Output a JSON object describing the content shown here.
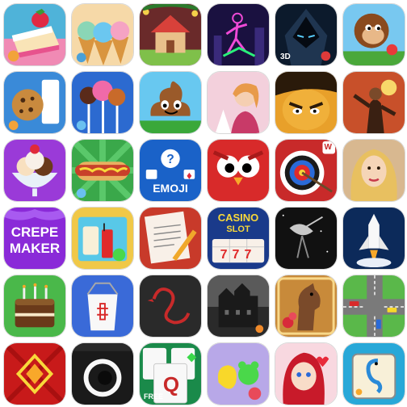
{
  "screen": {
    "apps": [
      {
        "icon": "strawberry-cake-icon"
      },
      {
        "icon": "ice-cream-cones-icon"
      },
      {
        "icon": "gingerbread-house-icon"
      },
      {
        "icon": "neon-stickman-icon"
      },
      {
        "icon": "hooded-warrior-3d-icon",
        "text": "3D"
      },
      {
        "icon": "monkey-runner-icon"
      },
      {
        "icon": "cookies-and-milk-icon"
      },
      {
        "icon": "cake-pops-icon"
      },
      {
        "icon": "smiling-poop-icon"
      },
      {
        "icon": "fashion-girl-icon"
      },
      {
        "icon": "angry-hero-icon"
      },
      {
        "icon": "gunslinger-icon"
      },
      {
        "icon": "ice-cream-sundae-icon"
      },
      {
        "icon": "hot-dog-icon"
      },
      {
        "icon": "emoji-quiz-icon",
        "text": "EMOJI"
      },
      {
        "icon": "red-owl-icon"
      },
      {
        "icon": "archery-target-icon",
        "text": "W"
      },
      {
        "icon": "blonde-woman-icon"
      },
      {
        "icon": "crepe-maker-icon",
        "text_lines": [
          "CREPE",
          "MAKER"
        ]
      },
      {
        "icon": "juice-and-firecracker-icon"
      },
      {
        "icon": "notepad-and-pencil-icon"
      },
      {
        "icon": "casino-slot-icon",
        "text_lines": [
          "CASINO",
          "SLOT",
          "777"
        ]
      },
      {
        "icon": "satellite-dish-icon"
      },
      {
        "icon": "space-shuttle-icon"
      },
      {
        "icon": "birthday-cake-icon"
      },
      {
        "icon": "takeout-box-icon"
      },
      {
        "icon": "red-swan-logo-icon"
      },
      {
        "icon": "haunted-mansion-icon"
      },
      {
        "icon": "horse-and-roses-icon"
      },
      {
        "icon": "traffic-intersection-icon"
      },
      {
        "icon": "red-diamond-tile-icon"
      },
      {
        "icon": "camera-lens-icon"
      },
      {
        "icon": "solitaire-cards-icon",
        "text": "FREE",
        "card_rank": "Q"
      },
      {
        "icon": "gummy-fruit-icon"
      },
      {
        "icon": "red-haired-girl-icon"
      },
      {
        "icon": "seahorse-mahjong-icon"
      }
    ]
  }
}
